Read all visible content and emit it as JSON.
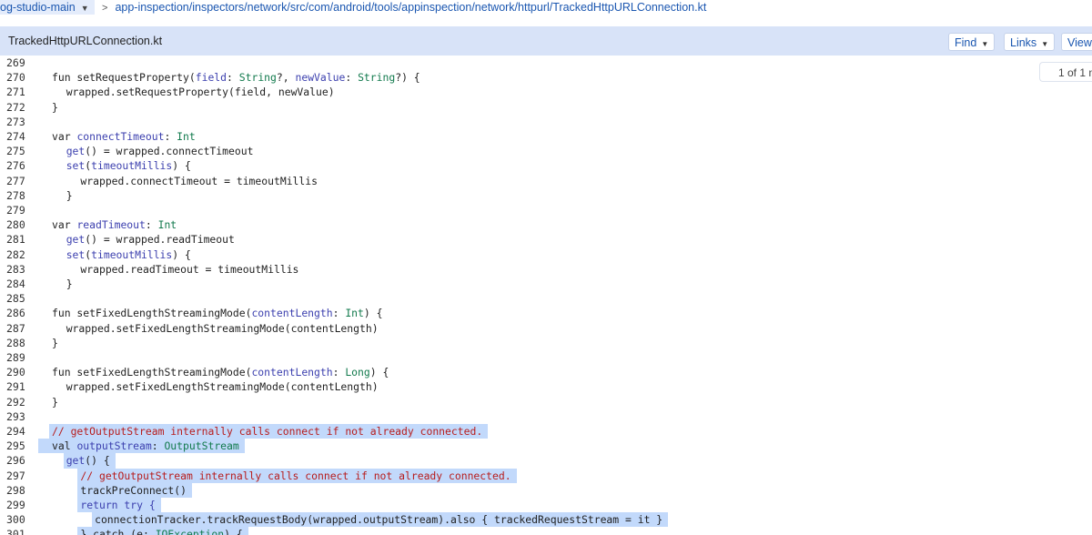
{
  "header": {
    "branch": "og-studio-main",
    "path": "app-inspection/inspectors/network/src/com/android/tools/appinspection/network/httpurl/TrackedHttpURLConnection.kt"
  },
  "file": {
    "name": "TrackedHttpURLConnection.kt",
    "buttons": {
      "find": "Find",
      "links": "Links",
      "view": "View"
    },
    "match_count": "1 of 1 m"
  },
  "lines": [
    {
      "n": "269",
      "hl": false,
      "indent": 0,
      "tokens": []
    },
    {
      "n": "270",
      "hl": false,
      "indent": 0,
      "tokens": [
        {
          "t": "fun setRequestProperty("
        },
        {
          "t": "field",
          "c": "pr"
        },
        {
          "t": ": "
        },
        {
          "t": "String",
          "c": "ty"
        },
        {
          "t": "?, "
        },
        {
          "t": "newValue",
          "c": "pr"
        },
        {
          "t": ": "
        },
        {
          "t": "String",
          "c": "ty"
        },
        {
          "t": "?) {"
        }
      ]
    },
    {
      "n": "271",
      "hl": false,
      "indent": 1,
      "tokens": [
        {
          "t": "wrapped.setRequestProperty(field, newValue)"
        }
      ]
    },
    {
      "n": "272",
      "hl": false,
      "indent": 0,
      "tokens": [
        {
          "t": "}"
        }
      ]
    },
    {
      "n": "273",
      "hl": false,
      "indent": 0,
      "tokens": []
    },
    {
      "n": "274",
      "hl": false,
      "indent": 0,
      "tokens": [
        {
          "t": "var "
        },
        {
          "t": "connectTimeout",
          "c": "pr"
        },
        {
          "t": ": "
        },
        {
          "t": "Int",
          "c": "ty"
        }
      ]
    },
    {
      "n": "275",
      "hl": false,
      "indent": 1,
      "tokens": [
        {
          "t": "get",
          "c": "kw"
        },
        {
          "t": "() = wrapped.connectTimeout"
        }
      ]
    },
    {
      "n": "276",
      "hl": false,
      "indent": 1,
      "tokens": [
        {
          "t": "set",
          "c": "kw"
        },
        {
          "t": "("
        },
        {
          "t": "timeoutMillis",
          "c": "pr"
        },
        {
          "t": ") {"
        }
      ]
    },
    {
      "n": "277",
      "hl": false,
      "indent": 2,
      "tokens": [
        {
          "t": "wrapped.connectTimeout = timeoutMillis"
        }
      ]
    },
    {
      "n": "278",
      "hl": false,
      "indent": 1,
      "tokens": [
        {
          "t": "}"
        }
      ]
    },
    {
      "n": "279",
      "hl": false,
      "indent": 0,
      "tokens": []
    },
    {
      "n": "280",
      "hl": false,
      "indent": 0,
      "tokens": [
        {
          "t": "var "
        },
        {
          "t": "readTimeout",
          "c": "pr"
        },
        {
          "t": ": "
        },
        {
          "t": "Int",
          "c": "ty"
        }
      ]
    },
    {
      "n": "281",
      "hl": false,
      "indent": 1,
      "tokens": [
        {
          "t": "get",
          "c": "kw"
        },
        {
          "t": "() = wrapped.readTimeout"
        }
      ]
    },
    {
      "n": "282",
      "hl": false,
      "indent": 1,
      "tokens": [
        {
          "t": "set",
          "c": "kw"
        },
        {
          "t": "("
        },
        {
          "t": "timeoutMillis",
          "c": "pr"
        },
        {
          "t": ") {"
        }
      ]
    },
    {
      "n": "283",
      "hl": false,
      "indent": 2,
      "tokens": [
        {
          "t": "wrapped.readTimeout = timeoutMillis"
        }
      ]
    },
    {
      "n": "284",
      "hl": false,
      "indent": 1,
      "tokens": [
        {
          "t": "}"
        }
      ]
    },
    {
      "n": "285",
      "hl": false,
      "indent": 0,
      "tokens": []
    },
    {
      "n": "286",
      "hl": false,
      "indent": 0,
      "tokens": [
        {
          "t": "fun setFixedLengthStreamingMode("
        },
        {
          "t": "contentLength",
          "c": "pr"
        },
        {
          "t": ": "
        },
        {
          "t": "Int",
          "c": "ty"
        },
        {
          "t": ") {"
        }
      ]
    },
    {
      "n": "287",
      "hl": false,
      "indent": 1,
      "tokens": [
        {
          "t": "wrapped.setFixedLengthStreamingMode(contentLength)"
        }
      ]
    },
    {
      "n": "288",
      "hl": false,
      "indent": 0,
      "tokens": [
        {
          "t": "}"
        }
      ]
    },
    {
      "n": "289",
      "hl": false,
      "indent": 0,
      "tokens": []
    },
    {
      "n": "290",
      "hl": false,
      "indent": 0,
      "tokens": [
        {
          "t": "fun setFixedLengthStreamingMode("
        },
        {
          "t": "contentLength",
          "c": "pr"
        },
        {
          "t": ": "
        },
        {
          "t": "Long",
          "c": "ty"
        },
        {
          "t": ") {"
        }
      ]
    },
    {
      "n": "291",
      "hl": false,
      "indent": 1,
      "tokens": [
        {
          "t": "wrapped.setFixedLengthStreamingMode(contentLength)"
        }
      ]
    },
    {
      "n": "292",
      "hl": false,
      "indent": 0,
      "tokens": [
        {
          "t": "}"
        }
      ]
    },
    {
      "n": "293",
      "hl": false,
      "indent": 0,
      "tokens": []
    },
    {
      "n": "294",
      "hl": true,
      "indent": 0,
      "tokens": [
        {
          "t": "// getOutputStream internally calls connect if not already connected.",
          "c": "cm"
        }
      ]
    },
    {
      "n": "295",
      "hl": true,
      "indent": 0,
      "tokens": [
        {
          "t": "val "
        },
        {
          "t": "outputStream",
          "c": "pr"
        },
        {
          "t": ": "
        },
        {
          "t": "OutputStream",
          "c": "ty"
        }
      ]
    },
    {
      "n": "296",
      "hl": true,
      "indent": 1,
      "tokens": [
        {
          "t": "get",
          "c": "kw"
        },
        {
          "t": "() {"
        }
      ]
    },
    {
      "n": "297",
      "hl": true,
      "indent": 2,
      "tokens": [
        {
          "t": "// getOutputStream internally calls connect if not already connected.",
          "c": "cm"
        }
      ]
    },
    {
      "n": "298",
      "hl": true,
      "indent": 2,
      "tokens": [
        {
          "t": "trackPreConnect()"
        }
      ]
    },
    {
      "n": "299",
      "hl": true,
      "indent": 2,
      "tokens": [
        {
          "t": "return try {",
          "c": "kw"
        }
      ]
    },
    {
      "n": "300",
      "hl": true,
      "indent": 3,
      "tokens": [
        {
          "t": "connectionTracker.trackRequestBody(wrapped.outputStream).also { trackedRequestStream = it }"
        }
      ]
    },
    {
      "n": "301",
      "hl": true,
      "indent": 2,
      "tokens": [
        {
          "t": "} catch (e: "
        },
        {
          "t": "IOException",
          "c": "ty"
        },
        {
          "t": ") {"
        }
      ]
    }
  ]
}
